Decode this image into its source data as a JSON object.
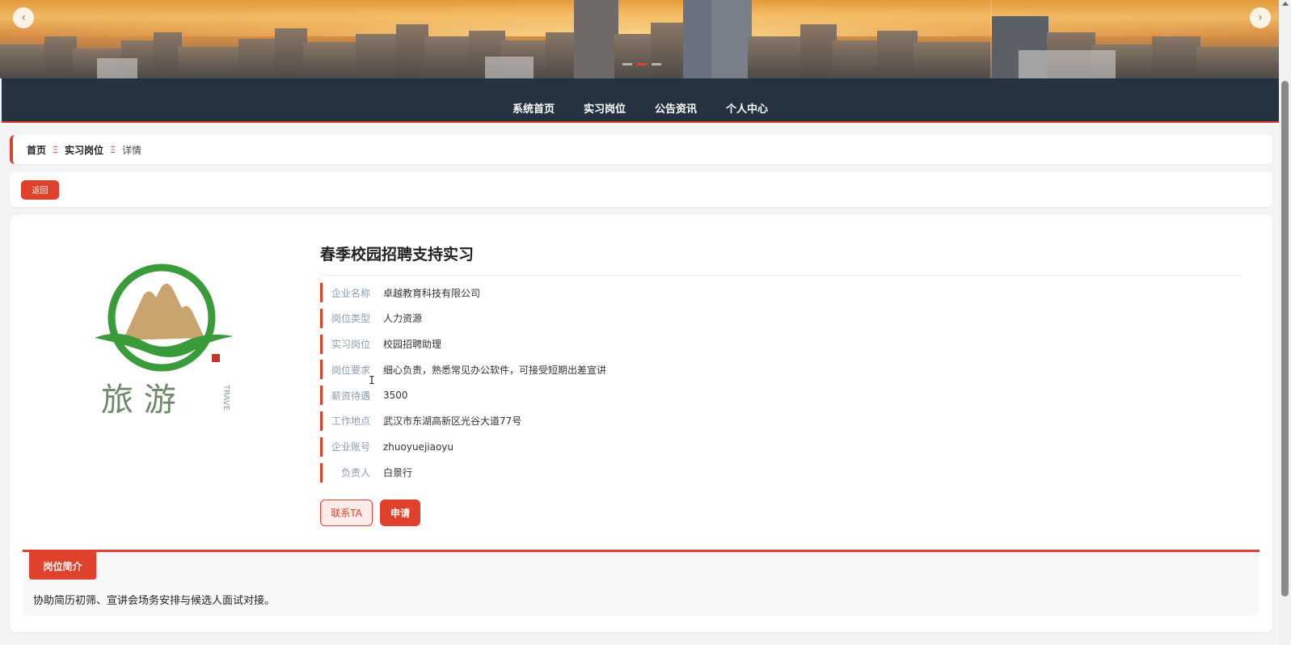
{
  "banner": {
    "prev_icon": "chevron-left-icon",
    "next_icon": "chevron-right-icon",
    "prev_glyph": "‹",
    "next_glyph": "›",
    "slide_count": 3,
    "active_slide": 1
  },
  "nav": {
    "items": [
      {
        "label": "系统首页"
      },
      {
        "label": "实习岗位"
      },
      {
        "label": "公告资讯"
      },
      {
        "label": "个人中心"
      }
    ]
  },
  "breadcrumb": {
    "home": "首页",
    "section": "实习岗位",
    "current": "详情",
    "sep": "Ξ"
  },
  "back_button": "返回",
  "job": {
    "title": "春季校园招聘支持实习",
    "logo_text": "旅  游",
    "logo_side_text": "TRAVE",
    "fields": [
      {
        "label": "企业名称",
        "value": "卓越教育科技有限公司"
      },
      {
        "label": "岗位类型",
        "value": "人力资源"
      },
      {
        "label": "实习岗位",
        "value": "校园招聘助理"
      },
      {
        "label": "岗位要求",
        "value": "细心负责，熟悉常见办公软件，可接受短期出差宣讲"
      },
      {
        "label": "薪资待遇",
        "value": "3500"
      },
      {
        "label": "工作地点",
        "value": "武汉市东湖高新区光谷大道77号"
      },
      {
        "label": "企业账号",
        "value": "zhuoyuejiaoyu"
      },
      {
        "label": "负责人",
        "value": "白景行"
      }
    ],
    "contact_button": "联系TA",
    "apply_button": "申请"
  },
  "description": {
    "tab_label": "岗位简介",
    "text": "协助简历初筛、宣讲会场务安排与候选人面试对接。"
  },
  "colors": {
    "accent": "#e0412c",
    "nav_bg": "#253340",
    "label": "#8c9db0",
    "logo_green": "#3a9b3a",
    "logo_tan": "#c9a46f"
  }
}
